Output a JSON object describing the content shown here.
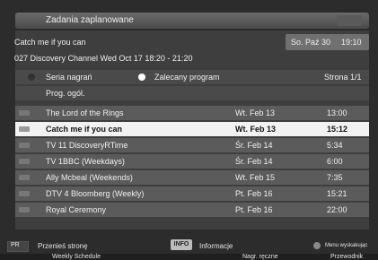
{
  "window": {
    "title": "Zadania zaplanowane"
  },
  "program": {
    "title": "Catch me if you can",
    "details": "027 Discovery Channel Wed Oct 17   18:20 - 21:20"
  },
  "datetime": {
    "date": "So. Paź 30",
    "time": "19:10"
  },
  "options": {
    "series": "Seria nagrań",
    "recommended": "Zalecany program",
    "page": "Strona 1/1"
  },
  "program_guide_label": "Prog. ogól.",
  "rows": [
    {
      "name": "The Lord of the Rings",
      "day": "Wt. Feb 13",
      "time": "13:00",
      "selected": false
    },
    {
      "name": "Catch me if you can",
      "day": "Wt. Feb 13",
      "time": "15:12",
      "selected": true
    },
    {
      "name": "TV 11 DiscoveryRTime",
      "day": "Śr. Feb 14",
      "time": "5:34",
      "selected": false
    },
    {
      "name": "TV 1BBC (Weekdays)",
      "day": "Śr. Feb 14",
      "time": "6:00",
      "selected": false
    },
    {
      "name": "Ally Mcbeal (Weekends)",
      "day": "Wt. Feb 15",
      "time": "7:35",
      "selected": false
    },
    {
      "name": "DTV 4 Bloomberg (Weekly)",
      "day": "Pt. Feb 16",
      "time": "15:21",
      "selected": false
    },
    {
      "name": "Royal Ceremony",
      "day": "Pt. Feb 16",
      "time": "22:00",
      "selected": false
    }
  ],
  "footer": {
    "pr_label": "PR",
    "move_page": "Przenieś stronę",
    "info_btn": "INFO",
    "info_label": "Informacje",
    "popup_menu": "Menu wyskakując",
    "weekly": "Weekly Schedule",
    "manual_rec": "Nagr. ręczne",
    "guide": "Przewodnik"
  },
  "colors": {
    "selected_row": "#f2f2f2",
    "row": "#5b5b5b",
    "background": "#2c2c2c"
  }
}
